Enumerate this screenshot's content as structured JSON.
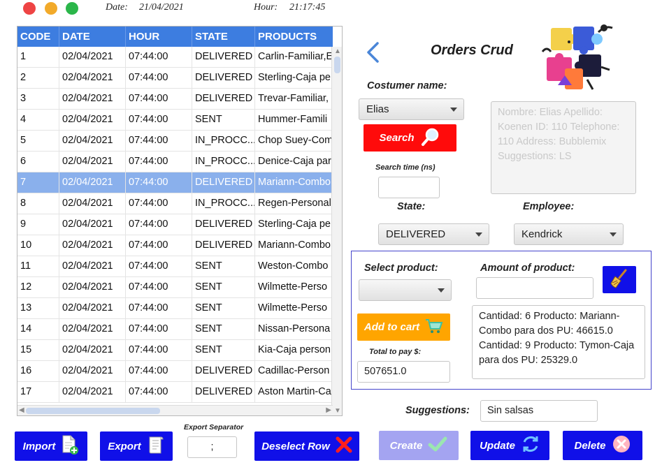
{
  "window": {
    "date_label": "Date:",
    "date_value": "21/04/2021",
    "hour_label": "Hour:",
    "hour_value": "21:17:45",
    "colors": {
      "close": "#ee4444",
      "minimize": "#f2aa2a",
      "maximize": "#2bb64a"
    }
  },
  "table": {
    "columns": [
      "CODE",
      "DATE",
      "HOUR",
      "STATE",
      "PRODUCTS"
    ],
    "rows": [
      [
        "1",
        "02/04/2021",
        "07:44:00",
        "DELIVERED",
        "Carlin-Familiar,E"
      ],
      [
        "2",
        "02/04/2021",
        "07:44:00",
        "DELIVERED",
        "Sterling-Caja pe"
      ],
      [
        "3",
        "02/04/2021",
        "07:44:00",
        "DELIVERED",
        "Trevar-Familiar,"
      ],
      [
        "4",
        "02/04/2021",
        "07:44:00",
        "SENT",
        "Hummer-Famili"
      ],
      [
        "5",
        "02/04/2021",
        "07:44:00",
        "IN_PROCC...",
        "Chop Suey-Com"
      ],
      [
        "6",
        "02/04/2021",
        "07:44:00",
        "IN_PROCC...",
        "Denice-Caja par"
      ],
      [
        "7",
        "02/04/2021",
        "07:44:00",
        "DELIVERED",
        "Mariann-Combo"
      ],
      [
        "8",
        "02/04/2021",
        "07:44:00",
        "IN_PROCC...",
        "Regen-Personal"
      ],
      [
        "9",
        "02/04/2021",
        "07:44:00",
        "DELIVERED",
        "Sterling-Caja pe"
      ],
      [
        "10",
        "02/04/2021",
        "07:44:00",
        "DELIVERED",
        "Mariann-Combo"
      ],
      [
        "11",
        "02/04/2021",
        "07:44:00",
        "SENT",
        "Weston-Combo"
      ],
      [
        "12",
        "02/04/2021",
        "07:44:00",
        "SENT",
        "Wilmette-Perso"
      ],
      [
        "13",
        "02/04/2021",
        "07:44:00",
        "SENT",
        "Wilmette-Perso"
      ],
      [
        "14",
        "02/04/2021",
        "07:44:00",
        "SENT",
        "Nissan-Persona"
      ],
      [
        "15",
        "02/04/2021",
        "07:44:00",
        "SENT",
        "Kia-Caja person"
      ],
      [
        "16",
        "02/04/2021",
        "07:44:00",
        "DELIVERED",
        "Cadillac-Person"
      ],
      [
        "17",
        "02/04/2021",
        "07:44:00",
        "DELIVERED",
        "Aston Martin-Ca"
      ]
    ],
    "selected_row": 7
  },
  "form": {
    "title": "Orders Crud",
    "customer_label": "Costumer name:",
    "customer_value": "Elias",
    "search_label": "Search",
    "search_time_label": "Search time (ns)",
    "search_time_value": "",
    "customer_info": "Nombre: Elias Apellido: Koenen ID: 110 Telephone: 110 Address: Bubblemix Suggestions: LS",
    "state_label": "State:",
    "state_value": "DELIVERED",
    "employee_label": "Employee:",
    "employee_value": "Kendrick",
    "select_product_label": "Select product:",
    "select_product_value": "",
    "amount_label": "Amount of product:",
    "amount_value": "",
    "add_to_cart_label": "Add to cart",
    "total_label": "Total to pay $:",
    "total_value": "507651.0",
    "cart_text": "Cantidad: 6 Producto: Mariann-Combo para dos PU: 46615.0 Cantidad: 9 Producto: Tymon-Caja para dos PU: 25329.0",
    "suggestions_label": "Suggestions:",
    "suggestions_value": "Sin salsas"
  },
  "toolbar": {
    "import_label": "Import",
    "export_label": "Export",
    "export_separator_label": "Export Separator",
    "export_separator_value": ";",
    "deselect_label": "Deselect Row",
    "create_label": "Create",
    "update_label": "Update",
    "delete_label": "Delete"
  },
  "icons": [
    "close-dot",
    "minimize-dot",
    "maximize-dot",
    "back-arrow-icon",
    "puzzle-illustration",
    "magnifier-icon",
    "broom-icon",
    "cart-icon",
    "import-file-icon",
    "export-doc-icon",
    "x-mark-icon",
    "check-icon",
    "refresh-icon",
    "delete-circle-icon"
  ]
}
